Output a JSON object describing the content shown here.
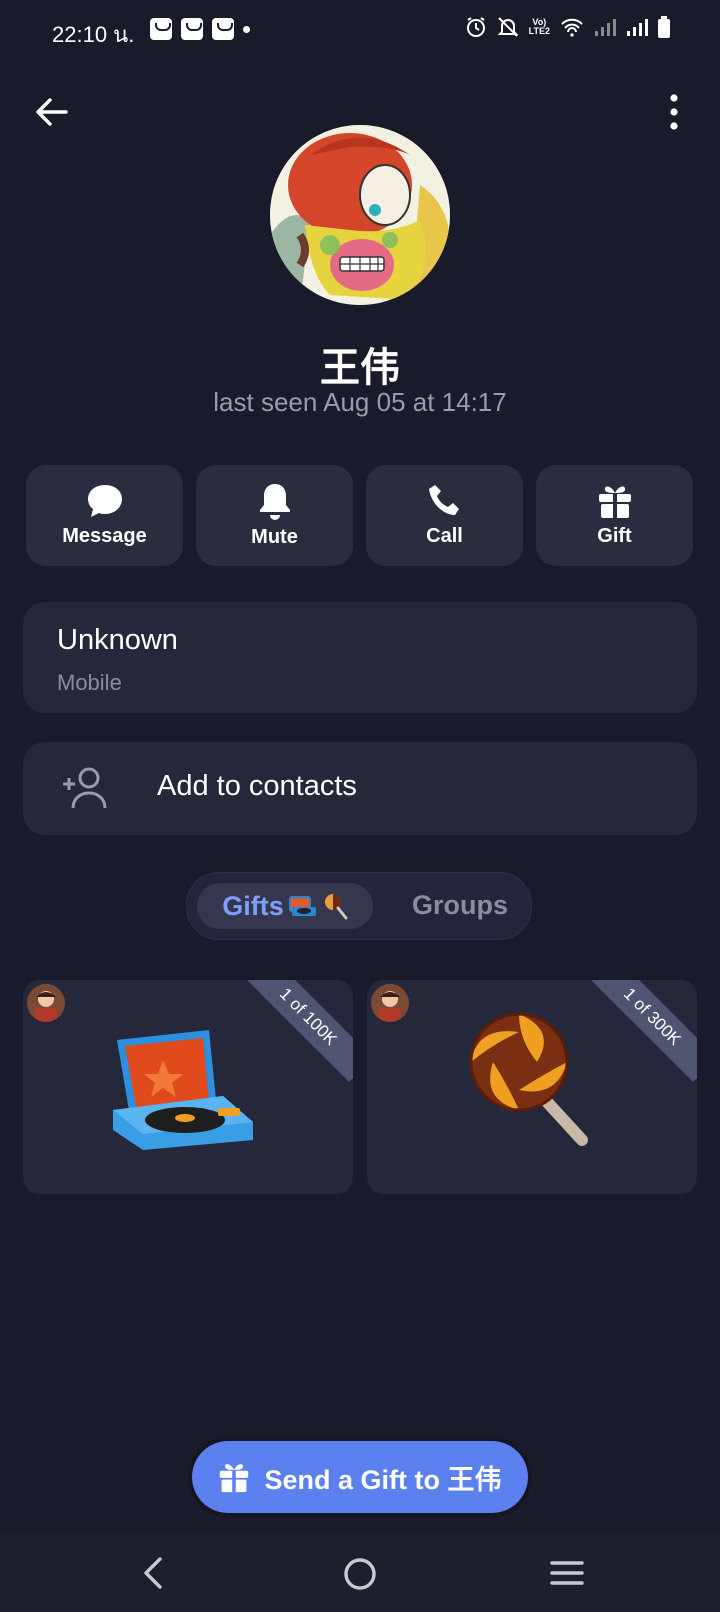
{
  "status_bar": {
    "time": "22:10 น.",
    "lte_label": "Vo)) LTE2"
  },
  "profile": {
    "name": "王伟",
    "last_seen": "last seen Aug 05 at 14:17"
  },
  "actions": [
    {
      "label": "Message",
      "icon": "chat-bubble-icon"
    },
    {
      "label": "Mute",
      "icon": "bell-icon"
    },
    {
      "label": "Call",
      "icon": "phone-icon"
    },
    {
      "label": "Gift",
      "icon": "gift-icon"
    }
  ],
  "info": {
    "value": "Unknown",
    "label": "Mobile"
  },
  "add_contact": {
    "label": "Add to contacts"
  },
  "tabs": [
    {
      "label": "Gifts",
      "active": true
    },
    {
      "label": "Groups",
      "active": false
    }
  ],
  "gifts": [
    {
      "name": "record player",
      "badge": "1 of 100K"
    },
    {
      "name": "lollipop",
      "badge": "1 of 300K"
    }
  ],
  "send_button": {
    "label": "Send a Gift to 王伟"
  },
  "colors": {
    "background": "#1a1b2a",
    "card": "#25273a",
    "accent": "#5b80f0",
    "tab_active_text": "#7f9fff"
  }
}
